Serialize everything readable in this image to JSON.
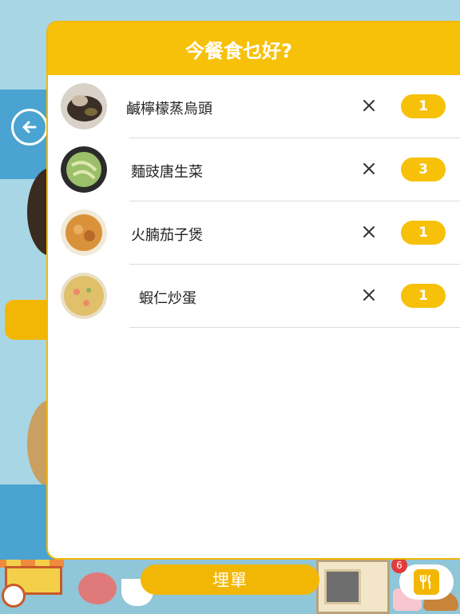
{
  "modal": {
    "title": "今餐食乜好?",
    "items": [
      {
        "name": "鹹檸檬蒸烏頭",
        "quantity": "1",
        "remove_icon": "close-icon"
      },
      {
        "name": "麵豉唐生菜",
        "quantity": "3",
        "remove_icon": "close-icon"
      },
      {
        "name": "火腩茄子煲",
        "quantity": "1",
        "remove_icon": "close-icon"
      },
      {
        "name": "蝦仁炒蛋",
        "quantity": "1",
        "remove_icon": "close-icon"
      }
    ]
  },
  "bottom": {
    "pay_label": "埋單",
    "cart_badge": "6",
    "menu_icon": "utensils-icon"
  },
  "background": {
    "back_icon": "arrow-left-circle-icon"
  },
  "colors": {
    "accent": "#f7c109",
    "button": "#f2b705",
    "band": "#4aa3d0",
    "sky": "#a9d6e5",
    "badge": "#e23b3b"
  }
}
